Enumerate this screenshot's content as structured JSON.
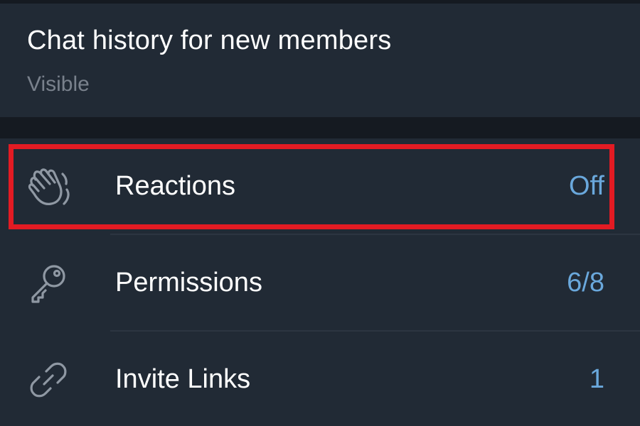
{
  "history": {
    "title": "Chat history for new members",
    "value": "Visible"
  },
  "rows": [
    {
      "label": "Reactions",
      "value": "Off",
      "icon": "waving-hand-icon"
    },
    {
      "label": "Permissions",
      "value": "6/8",
      "icon": "key-icon"
    },
    {
      "label": "Invite Links",
      "value": "1",
      "icon": "link-icon"
    }
  ],
  "colors": {
    "background": "#212a35",
    "separator": "#151a21",
    "accent": "#6aa8dc",
    "highlight": "#e31b23"
  }
}
